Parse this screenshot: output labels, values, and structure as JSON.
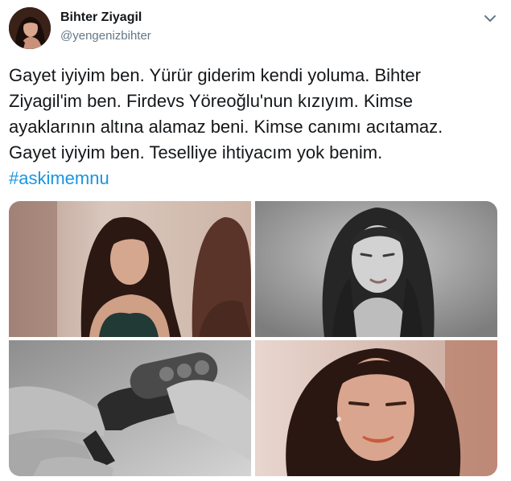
{
  "tweet": {
    "author": {
      "name": "Bihter Ziyagil",
      "handle": "@yengenizbihter"
    },
    "text_lines": [
      "Gayet iyiyim ben. Yürür giderim kendi yoluma. Bihter",
      "Ziyagil'im ben. Firdevs Yöreoğlu'nun kızıyım. Kimse",
      "ayaklarının altına alamaz beni. Kimse canımı acıtamaz.",
      "Gayet iyiyim ben. Teselliye ihtiyacım yok benim."
    ],
    "hashtag": "#askimemnu",
    "menu_icon": "chevron-down-icon",
    "media_count": 4
  },
  "colors": {
    "text": "#14171a",
    "secondary": "#657786",
    "link": "#1b95e0"
  }
}
